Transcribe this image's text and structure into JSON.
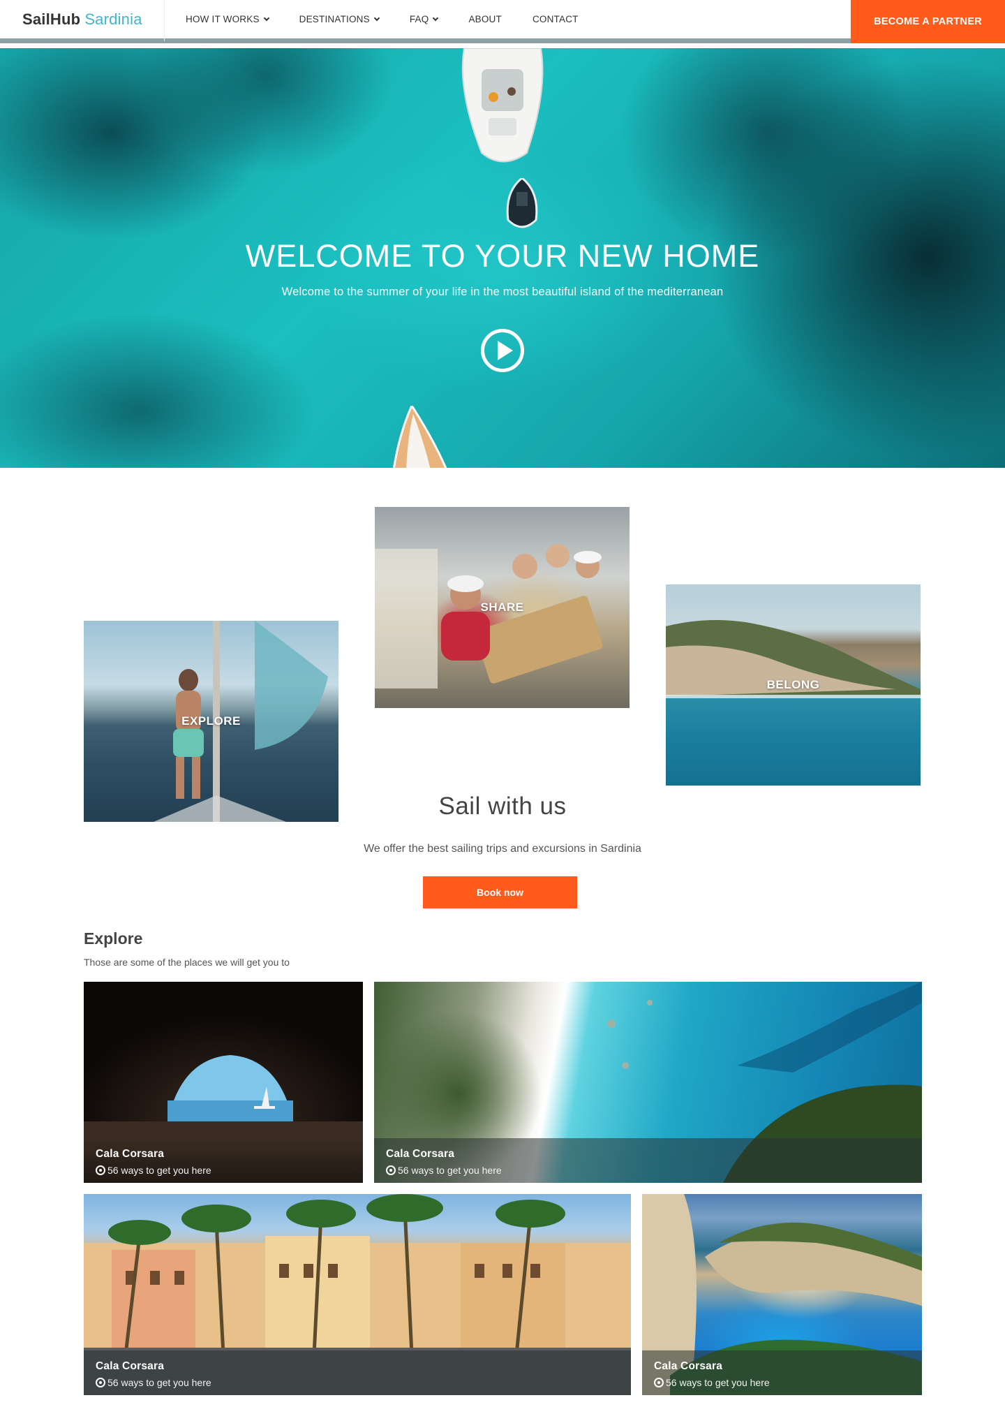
{
  "nav": {
    "brand_main": "SailHub",
    "brand_accent": "Sardinia",
    "items": [
      {
        "label": "HOW IT WORKS",
        "dropdown": true
      },
      {
        "label": "DESTINATIONS",
        "dropdown": true
      },
      {
        "label": "FAQ",
        "dropdown": true
      },
      {
        "label": "ABOUT",
        "dropdown": false
      },
      {
        "label": "CONTACT",
        "dropdown": false
      }
    ],
    "partner_label": "BECOME A PARTNER"
  },
  "hero": {
    "title": "WELCOME TO YOUR NEW HOME",
    "subtitle": "Welcome to the summer of your life in the most beautiful island of the mediterranean",
    "play_icon": "play-circle-icon"
  },
  "tiles": {
    "explore": "EXPLORE",
    "share": "SHARE",
    "belong": "BELONG"
  },
  "sail": {
    "title": "Sail with us",
    "subtitle": "We offer the best sailing trips and excursions in Sardinia",
    "button": "Book now"
  },
  "explore": {
    "heading": "Explore",
    "subheading": "Those are some of the places we will get you to",
    "cards": [
      {
        "title": "Cala Corsara",
        "meta": "56 ways to get you here"
      },
      {
        "title": "Cala Corsara",
        "meta": "56 ways to get you here"
      },
      {
        "title": "Cala Corsara",
        "meta": "56 ways to get you here"
      },
      {
        "title": "Cala Corsara",
        "meta": "56 ways to get you here"
      }
    ]
  },
  "colors": {
    "accent": "#ff5b1a",
    "brand_teal": "#3fb7c7"
  }
}
